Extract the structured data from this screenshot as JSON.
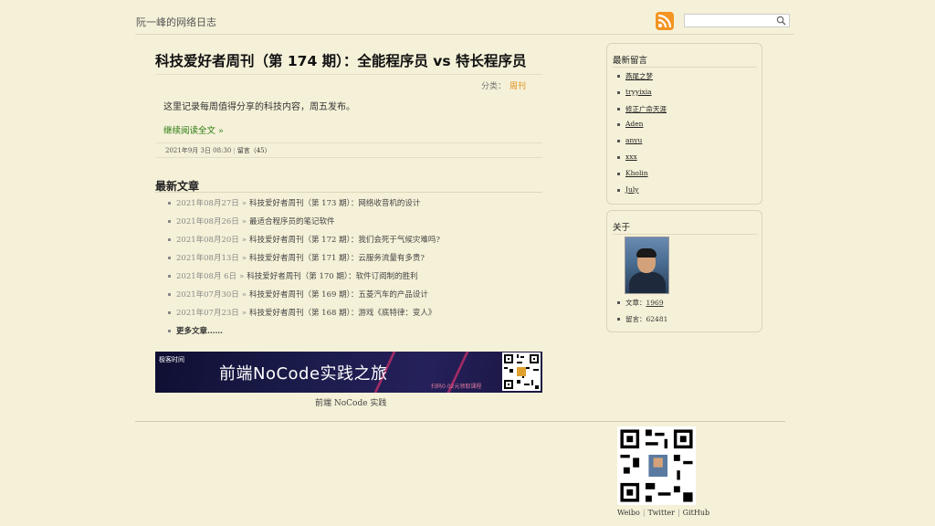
{
  "site": {
    "title": "阮一峰的网络日志"
  },
  "header": {
    "search_placeholder": "",
    "rss_icon": "rss-icon",
    "search_icon": "search-icon"
  },
  "post": {
    "title": "科技爱好者周刊（第 174 期）：全能程序员 vs 特长程序员",
    "category_label": "分类：",
    "category": "周刊",
    "excerpt": "这里记录每周值得分享的科技内容，周五发布。",
    "read_more": "继续阅读全文 »",
    "date": "2021年9月 3日 08:30",
    "comments": "留言（45）"
  },
  "recent": {
    "heading": "最新文章",
    "items": [
      {
        "date": "2021年08月27日",
        "title": "科技爱好者周刊（第 173 期）：网络收音机的设计"
      },
      {
        "date": "2021年08月26日",
        "title": "最适合程序员的笔记软件"
      },
      {
        "date": "2021年08月20日",
        "title": "科技爱好者周刊（第 172 期）：我们会死于气候灾难吗?"
      },
      {
        "date": "2021年08月13日",
        "title": "科技爱好者周刊（第 171 期）：云服务流量有多贵?"
      },
      {
        "date": "2021年08月 6日",
        "title": "科技爱好者周刊（第 170 期）：软件订阅制的胜利"
      },
      {
        "date": "2021年07月30日",
        "title": "科技爱好者周刊（第 169 期）：五菱汽车的产品设计"
      },
      {
        "date": "2021年07月23日",
        "title": "科技爱好者周刊（第 168 期）：游戏《底特律：变人》"
      }
    ],
    "more": "更多文章……"
  },
  "banner": {
    "logo": "极客时间",
    "text": "前端NoCode实践之旅",
    "subtext": "扫码0.02元领取课程",
    "caption": "前端 NoCode 实践"
  },
  "sidebar": {
    "comments_title": "最新留言",
    "commenters": [
      "燕尾之梦",
      "tryyixia",
      "修正广命天涯",
      "Aden",
      "anyu",
      "xxx",
      "Kholin",
      "July"
    ],
    "about_title": "关于",
    "stats": [
      {
        "label": "文章：",
        "value": "1969"
      },
      {
        "label": "留言：",
        "value": "62481"
      }
    ]
  },
  "footer": {
    "links": [
      "Weibo",
      "Twitter",
      "GitHub"
    ]
  }
}
